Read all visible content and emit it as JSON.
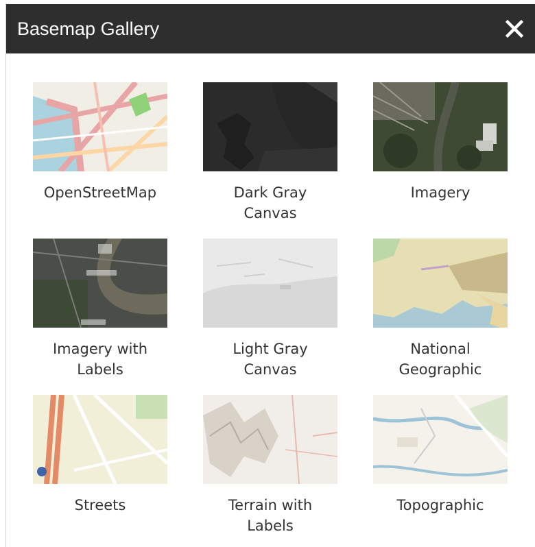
{
  "header": {
    "title": "Basemap Gallery",
    "close_icon": "close-icon"
  },
  "basemaps": [
    {
      "label": "OpenStreetMap"
    },
    {
      "label": "Dark Gray\nCanvas"
    },
    {
      "label": "Imagery"
    },
    {
      "label": "Imagery with\nLabels"
    },
    {
      "label": "Light Gray\nCanvas"
    },
    {
      "label": "National\nGeographic"
    },
    {
      "label": "Streets"
    },
    {
      "label": "Terrain with\nLabels"
    },
    {
      "label": "Topographic"
    }
  ]
}
